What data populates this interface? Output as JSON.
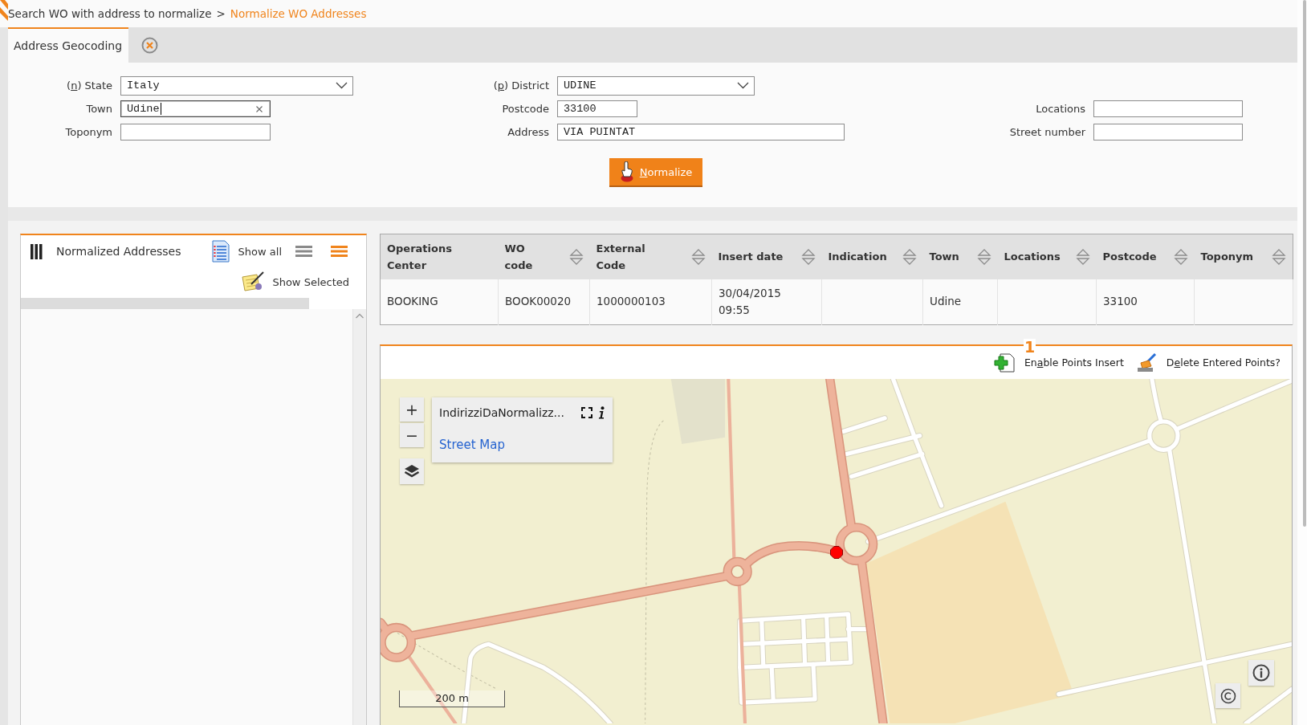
{
  "breadcrumb": {
    "items": [
      {
        "label": "Search WO with address to normalize",
        "selected": false
      },
      {
        "label": "Normalize WO Addresses",
        "selected": true
      }
    ],
    "separator": ">"
  },
  "tabs": [
    {
      "label": "Address Geocoding",
      "selected": true,
      "closable": true
    }
  ],
  "form": {
    "rows": [
      [
        {
          "kind": "select",
          "label_hotkey": {
            "before": "(",
            "key": "n",
            "after": ") State"
          },
          "value": "Italy",
          "focused": false
        },
        {
          "kind": "select",
          "label_hotkey": {
            "before": "(",
            "key": "p",
            "after": ") District"
          },
          "value": "UDINE",
          "focused": false
        }
      ],
      [
        {
          "kind": "input",
          "label": "Town",
          "value": "Udine",
          "focused": true
        },
        {
          "kind": "input",
          "label": "Postcode",
          "value": "33100",
          "focused": false
        },
        {
          "kind": "input",
          "label": "Locations",
          "focused": false
        }
      ],
      [
        {
          "kind": "input",
          "label": "Toponym",
          "focused": false
        },
        {
          "kind": "input",
          "label": "Address",
          "value": "VIA PUINTAT",
          "focused": false
        },
        {
          "kind": "input",
          "label": "Street number",
          "focused": false
        }
      ]
    ],
    "submit": {
      "label_hotkey": {
        "key": "N",
        "after": "ormalize"
      }
    }
  },
  "left_panel": {
    "title": "Normalized Addresses",
    "show_all": "Show all",
    "view_toggles": [
      {
        "selected": false
      },
      {
        "selected": true
      }
    ],
    "show_selected": "Show Selected"
  },
  "table": {
    "columns": [
      {
        "label": "Operations Center",
        "sortable": false
      },
      {
        "label": "WO code",
        "sortable": true
      },
      {
        "label": "External Code",
        "sortable": true
      },
      {
        "label": "Insert date",
        "sortable": true
      },
      {
        "label": "Indication",
        "sortable": true
      },
      {
        "label": "Town",
        "sortable": true
      },
      {
        "label": "Locations",
        "sortable": true
      },
      {
        "label": "Postcode",
        "sortable": true
      },
      {
        "label": "Toponym",
        "sortable": true
      }
    ],
    "rows": [
      {
        "operations_center": "BOOKING",
        "wo_code": "BOOK00020",
        "external_code": "1000000103",
        "insert_date": "30/04/2015 09:55",
        "town": "Udine",
        "postcode": "33100"
      }
    ]
  },
  "map_panel": {
    "badge": "1",
    "actions": [
      {
        "kind": "add_points",
        "label_hotkey": {
          "before": "En",
          "key": "a",
          "after": "ble Points Insert"
        }
      },
      {
        "kind": "delete_points",
        "label_hotkey": {
          "before": "D",
          "key": "e",
          "after": "lete Entered Points?"
        }
      }
    ],
    "map": {
      "zoom_in": "+",
      "zoom_out": "−",
      "layer_name": "IndirizziDaNormalizz...",
      "base_map": "Street Map",
      "scale": "200 m"
    }
  }
}
